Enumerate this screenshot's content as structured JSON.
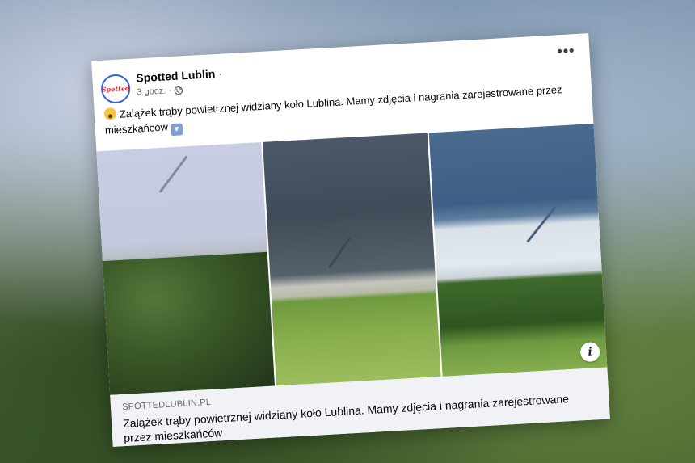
{
  "post": {
    "page_name": "Spotted Lublin",
    "name_separator": "·",
    "avatar_text": "Spotted",
    "time": "3 godz.",
    "time_separator": "·",
    "audience_icon": "globe-icon",
    "more_icon": "more-horizontal-icon",
    "more_label": "•••",
    "text": "Zalążek trąby powietrznej widziany koło Lublina. Mamy zdjęcia i nagrania zarejestrowane przez mieszkańców",
    "emoji_start": "face-screaming-in-fear",
    "emoji_end": "down-arrow-button",
    "emoji_end_glyph": "▼"
  },
  "link": {
    "domain": "SPOTTEDLUBLIN.PL",
    "title": "Zalążek trąby powietrznej widziany koło Lublina. Mamy zdjęcia i nagrania zarejestrowane przez mieszkańców",
    "info_label": "i"
  },
  "colors": {
    "avatar_ring": "#2d66d6",
    "avatar_text": "#e0222b",
    "link_bg": "#f0f2f5"
  }
}
